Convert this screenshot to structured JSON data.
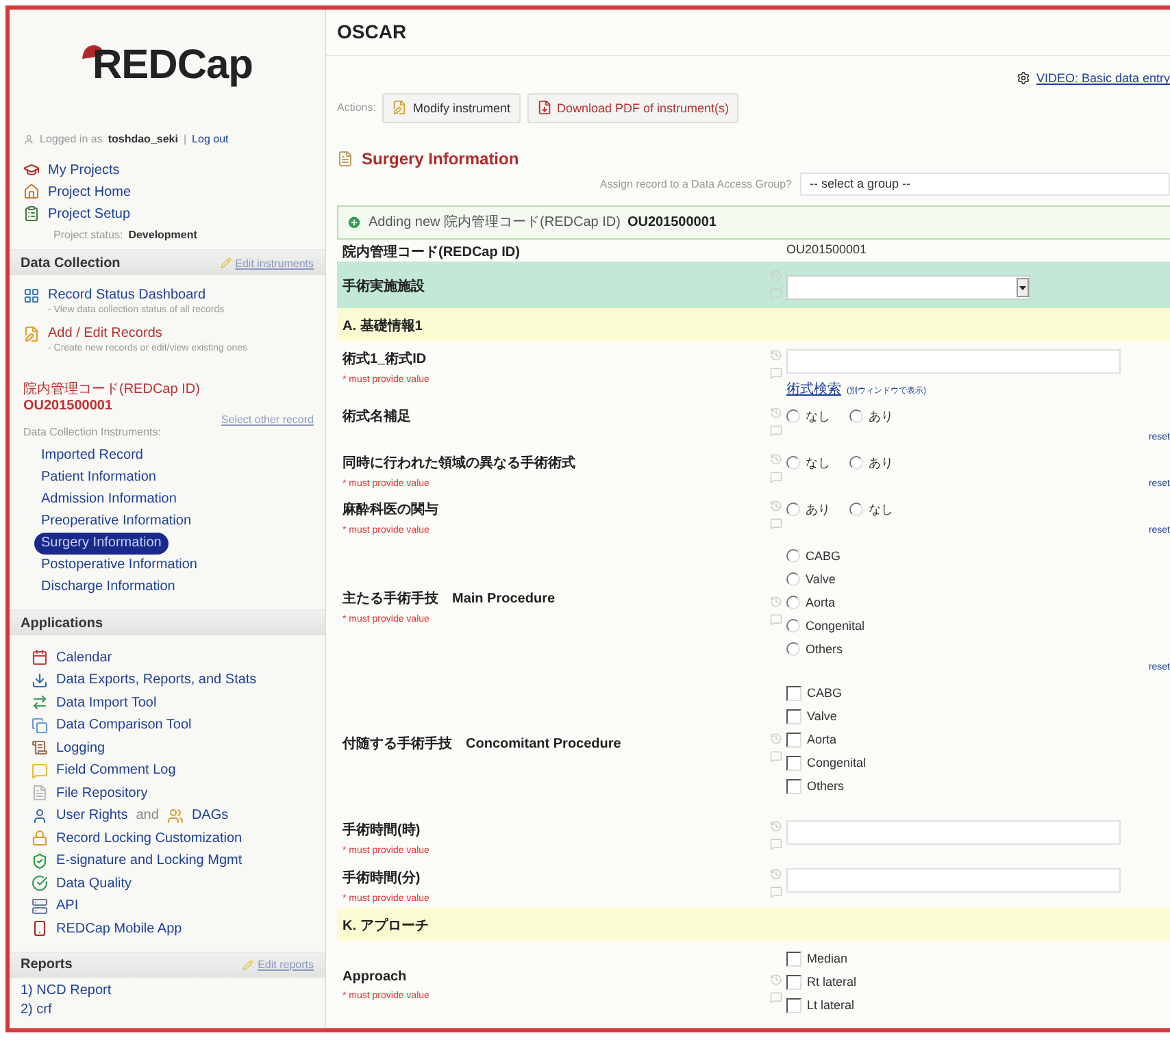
{
  "sidebar": {
    "logo": "REDCap",
    "login": {
      "prefix": "Logged in as",
      "user": "toshdao_seki",
      "separator": "|",
      "logout": "Log out"
    },
    "nav": [
      {
        "label": "My Projects"
      },
      {
        "label": "Project Home"
      },
      {
        "label": "Project Setup"
      }
    ],
    "project_status": {
      "label": "Project status:",
      "value": "Development"
    },
    "data_collection": {
      "title": "Data Collection",
      "edit": "Edit instruments",
      "links": [
        {
          "label": "Record Status Dashboard",
          "note": "- View data collection status of all records"
        },
        {
          "label": "Add / Edit Records",
          "note": "- Create new records or edit/view existing ones"
        }
      ],
      "record": {
        "label": "院内管理コード(REDCap ID)",
        "id": "OU201500001",
        "select_other": "Select other record"
      },
      "instruments_label": "Data Collection Instruments:",
      "instruments": [
        {
          "label": "Imported Record",
          "selected": false
        },
        {
          "label": "Patient Information",
          "selected": false
        },
        {
          "label": "Admission Information",
          "selected": false
        },
        {
          "label": "Preoperative Information",
          "selected": false
        },
        {
          "label": "Surgery Information",
          "selected": true
        },
        {
          "label": "Postoperative Information",
          "selected": false
        },
        {
          "label": "Discharge Information",
          "selected": false
        }
      ]
    },
    "applications": {
      "title": "Applications",
      "items": [
        {
          "label": "Calendar"
        },
        {
          "label": "Data Exports, Reports, and Stats"
        },
        {
          "label": "Data Import Tool"
        },
        {
          "label": "Data Comparison Tool"
        },
        {
          "label": "Logging"
        },
        {
          "label": "Field Comment Log"
        },
        {
          "label": "File Repository"
        },
        {
          "label": "User Rights",
          "joiner": "and",
          "extra": "DAGs"
        },
        {
          "label": "Record Locking Customization"
        },
        {
          "label": "E-signature and Locking Mgmt"
        },
        {
          "label": "Data Quality"
        },
        {
          "label": "API"
        },
        {
          "label": "REDCap Mobile App"
        }
      ]
    },
    "reports": {
      "title": "Reports",
      "edit": "Edit reports",
      "items": [
        "1) NCD Report",
        "2) crf"
      ]
    }
  },
  "main": {
    "title": "OSCAR",
    "video_link": "VIDEO: Basic data entry",
    "actions": {
      "label": "Actions:",
      "buttons": [
        {
          "label": "Modify instrument",
          "kind": "modify"
        },
        {
          "label": "Download PDF of instrument(s)",
          "kind": "pdf"
        }
      ]
    },
    "form_title": "Surgery Information",
    "dag": {
      "label": "Assign record to a Data Access Group?",
      "placeholder": "-- select a group --"
    },
    "banner": {
      "prefix": "Adding new 院内管理コード(REDCap ID)",
      "id": "OU201500001"
    },
    "rows": [
      {
        "kind": "id",
        "label": "院内管理コード(REDCap ID)",
        "value": "OU201500001"
      },
      {
        "kind": "select",
        "label": "手術実施施設"
      },
      {
        "kind": "section",
        "label": "A. 基礎情報1"
      },
      {
        "kind": "text",
        "label": "術式1_術式ID",
        "required": "* must provide value",
        "link": "術式検索",
        "link_note": "(別ウィンドウで表示)"
      },
      {
        "kind": "radio",
        "label": "術式名補足",
        "options": [
          {
            "label": "なし",
            "checked": false
          },
          {
            "label": "あり",
            "checked": false
          }
        ],
        "reset": "reset"
      },
      {
        "kind": "radio",
        "label": "同時に行われた領域の異なる手術術式",
        "required": "* must provide value",
        "options": [
          {
            "label": "なし",
            "checked": false
          },
          {
            "label": "あり",
            "checked": false
          }
        ],
        "reset": "reset"
      },
      {
        "kind": "radio",
        "label": "麻酔科医の関与",
        "required": "* must provide value",
        "options": [
          {
            "label": "あり",
            "checked": false
          },
          {
            "label": "なし",
            "checked": false
          }
        ],
        "reset": "reset"
      },
      {
        "kind": "radio",
        "label": "主たる手術手技　Main Procedure",
        "required": "* must provide value",
        "options": [
          {
            "label": "CABG",
            "checked": false
          },
          {
            "label": "Valve",
            "checked": false
          },
          {
            "label": "Aorta",
            "checked": false
          },
          {
            "label": "Congenital",
            "checked": false
          },
          {
            "label": "Others",
            "checked": false
          }
        ],
        "reset": "reset"
      },
      {
        "kind": "checkbox",
        "label": "付随する手術手技　Concomitant Procedure",
        "options": [
          {
            "label": "CABG",
            "checked": false
          },
          {
            "label": "Valve",
            "checked": false
          },
          {
            "label": "Aorta",
            "checked": false
          },
          {
            "label": "Congenital",
            "checked": false
          },
          {
            "label": "Others",
            "checked": false
          }
        ]
      },
      {
        "kind": "text",
        "label": "手術時間(時)",
        "required": "* must provide value"
      },
      {
        "kind": "text",
        "label": "手術時間(分)",
        "required": "* must provide value"
      },
      {
        "kind": "section",
        "label": "K. アプローチ"
      },
      {
        "kind": "checkbox",
        "label": "Approach",
        "required": "* must provide value",
        "options": [
          {
            "label": "Median",
            "checked": false
          },
          {
            "label": "Rt lateral",
            "checked": false
          },
          {
            "label": "Lt lateral",
            "checked": false
          }
        ]
      }
    ]
  }
}
